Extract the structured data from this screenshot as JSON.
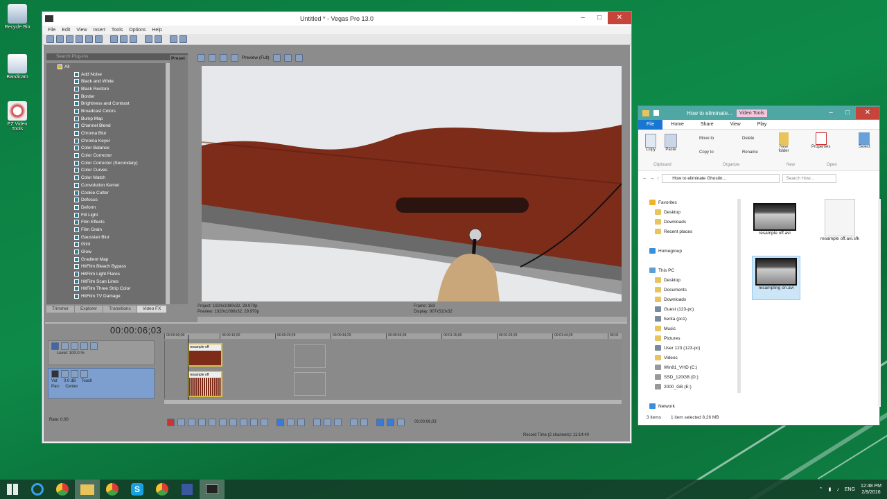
{
  "desktop": {
    "icons": [
      {
        "label": "Recycle Bin",
        "icon": "recycle-bin-icon"
      },
      {
        "label": "Bandicam",
        "icon": "bandicam-icon"
      },
      {
        "label": "EZ Video Tools",
        "icon": "app-icon"
      }
    ]
  },
  "vegas": {
    "title": "Untitled * - Vegas Pro 13.0",
    "menu": [
      "File",
      "Edit",
      "View",
      "Insert",
      "Tools",
      "Options",
      "Help"
    ],
    "search_placeholder": "Search Plug-Ins",
    "fx_root": "All",
    "preset_header": "Preset",
    "fx_list": [
      "Add Noise",
      "Black and White",
      "Black Restore",
      "Border",
      "Brightness and Contrast",
      "Broadcast Colors",
      "Bump Map",
      "Channel Blend",
      "Chroma Blur",
      "Chroma Keyer",
      "Color Balance",
      "Color Corrector",
      "Color Corrector (Secondary)",
      "Color Curves",
      "Color Match",
      "Convolution Kernel",
      "Cookie Cutter",
      "Defocus",
      "Deform",
      "Fill Light",
      "Film Effects",
      "Film Grain",
      "Gaussian Blur",
      "Glint",
      "Glow",
      "Gradient Map",
      "HitFilm Bleach Bypass",
      "HitFilm Light Flares",
      "HitFilm Scan Lines",
      "HitFilm Three Strip Color",
      "HitFilm TV Damage"
    ],
    "bottom_tabs": [
      "Trimmer",
      "Explorer",
      "Transitions",
      "Video FX"
    ],
    "preview_label": "Preview (Full)",
    "project_info": {
      "project": "Project:  1920x1080x32, 29.970p",
      "preview": "Preview:  1920x1080x32, 29.970p",
      "frame": "Frame:   183",
      "display": "Display:  907x510x32"
    },
    "timecode": "00:00:06;03",
    "ruler": [
      "00:00:00;00",
      "00:00:15;00",
      "00:00:29;29",
      "00:00:44;29",
      "00:00:59;28",
      "00:01:15;00",
      "00:01:29;29",
      "00:01:44;29",
      "00:01"
    ],
    "track1": {
      "level": "Level: 100.0 %",
      "clip": "resample off"
    },
    "track2": {
      "vol": "Vol:",
      "vol_value": "0.0 dB",
      "pan": "Pan:",
      "pan_value": "Center",
      "touch": "Touch",
      "clip": "resample off"
    },
    "rate": "Rate: 0.00",
    "transport_time": "00:00:06;03",
    "status": "Record Time (2 channels): 11:14:40"
  },
  "explorer": {
    "tool_tab": "Video Tools",
    "title": "How to eliminate...",
    "ribbon_tabs": [
      "File",
      "Home",
      "Share",
      "View",
      "Play"
    ],
    "ribbon": {
      "copy": "Copy",
      "paste": "Paste",
      "clipboard": "Clipboard",
      "move_to": "Move to",
      "copy_to": "Copy to",
      "delete": "Delete",
      "rename": "Rename",
      "organize": "Organize",
      "new_folder": "New folder",
      "new": "New",
      "properties": "Properties",
      "open": "Open",
      "select": "Select"
    },
    "address": "How to eliminate Ghostin...",
    "search_placeholder": "Search How...",
    "nav": [
      {
        "label": "Favorites",
        "icon": "star-icon",
        "indent": 0
      },
      {
        "label": "Desktop",
        "icon": "folder-icon",
        "indent": 1
      },
      {
        "label": "Downloads",
        "icon": "folder-icon",
        "indent": 1
      },
      {
        "label": "Recent places",
        "icon": "folder-icon",
        "indent": 1
      },
      {
        "label": "",
        "icon": "",
        "indent": 0
      },
      {
        "label": "Homegroup",
        "icon": "homegroup-icon",
        "indent": 0
      },
      {
        "label": "",
        "icon": "",
        "indent": 0
      },
      {
        "label": "This PC",
        "icon": "pc-icon",
        "indent": 0
      },
      {
        "label": "Desktop",
        "icon": "folder-icon",
        "indent": 1
      },
      {
        "label": "Documents",
        "icon": "folder-icon",
        "indent": 1
      },
      {
        "label": "Downloads",
        "icon": "folder-icon",
        "indent": 1
      },
      {
        "label": "Guest (123-pc)",
        "icon": "user-icon",
        "indent": 1
      },
      {
        "label": "henta (pc1)",
        "icon": "user-icon",
        "indent": 1
      },
      {
        "label": "Music",
        "icon": "folder-icon",
        "indent": 1
      },
      {
        "label": "Pictures",
        "icon": "folder-icon",
        "indent": 1
      },
      {
        "label": "User 123 (123-pc)",
        "icon": "user-icon",
        "indent": 1
      },
      {
        "label": "Videos",
        "icon": "folder-icon",
        "indent": 1
      },
      {
        "label": "Win81_VHD (C:)",
        "icon": "drive-icon",
        "indent": 1
      },
      {
        "label": "SSD_120GB (D:)",
        "icon": "drive-icon",
        "indent": 1
      },
      {
        "label": "2000_GB (E:)",
        "icon": "drive-icon",
        "indent": 1
      },
      {
        "label": "",
        "icon": "",
        "indent": 0
      },
      {
        "label": "Network",
        "icon": "network-icon",
        "indent": 0
      }
    ],
    "files": [
      {
        "name": "resample off.avi",
        "type": "video"
      },
      {
        "name": "resample off.avi.sfk",
        "type": "doc"
      },
      {
        "name": "resampling on.avi",
        "type": "video",
        "selected": true
      }
    ],
    "status_left": "3 items",
    "status_sel": "1 item selected  8.26 MB"
  },
  "taskbar": {
    "apps": [
      "start-icon",
      "ie-icon",
      "chrome-icon",
      "file-explorer-icon",
      "chrome-icon",
      "skype-icon",
      "save-icon",
      "vegas-icon"
    ],
    "lang": "ENG",
    "time": "12:48 PM",
    "date": "2/9/2016"
  }
}
